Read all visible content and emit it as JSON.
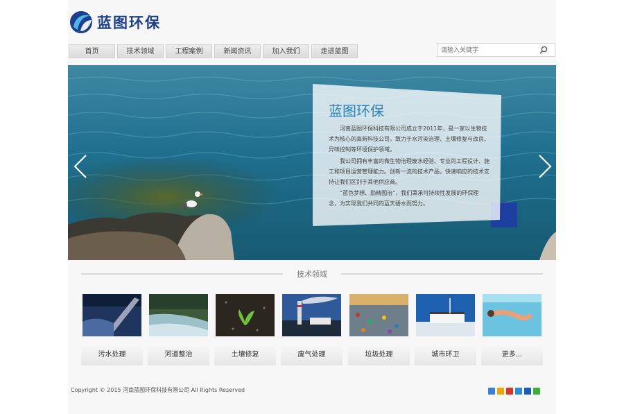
{
  "brand": {
    "name": "蓝图环保"
  },
  "nav": {
    "items": [
      {
        "label": "首页"
      },
      {
        "label": "技术领域"
      },
      {
        "label": "工程案例"
      },
      {
        "label": "新闻资讯"
      },
      {
        "label": "加入我们"
      },
      {
        "label": "走进蓝图"
      }
    ]
  },
  "search": {
    "placeholder": "请输入关键字"
  },
  "banner": {
    "title": "蓝图环保",
    "paragraphs": [
      "河南蓝图环保科技有限公司成立于2011年，是一家以生物技术为核心的高新科技公司，致力于水污染治理、土壤修复与改良、异味控制等环境保护领域。",
      "我公司拥有丰富的微生物治理废水经验、专业的工程设计、施工和项目运营管理能力。创新一流的技术产品，快速响应的技术支持让我们区别于其他供应商。",
      "“蓝色梦想、励精图治”，我们秉承可持续性发展的环保理念，为实现我们共同的蓝天碧水而努力。"
    ]
  },
  "section": {
    "title": "技术领域"
  },
  "categories": [
    {
      "label": "污水处理",
      "icon": "wastewater-photo"
    },
    {
      "label": "河道整治",
      "icon": "river-photo"
    },
    {
      "label": "土壤修复",
      "icon": "soil-photo"
    },
    {
      "label": "废气处理",
      "icon": "exhaust-photo"
    },
    {
      "label": "垃圾处理",
      "icon": "garbage-photo"
    },
    {
      "label": "城市环卫",
      "icon": "sanitation-photo"
    },
    {
      "label": "更多...",
      "icon": "swimming-photo"
    }
  ],
  "footer": {
    "copyright": "Copyright © 2015 河南蓝图环保科技有限公司 All Rights Reserved"
  },
  "colors": {
    "brand": "#1d3f8f",
    "accent": "#2a83b8",
    "water": "#1d6a8c"
  }
}
